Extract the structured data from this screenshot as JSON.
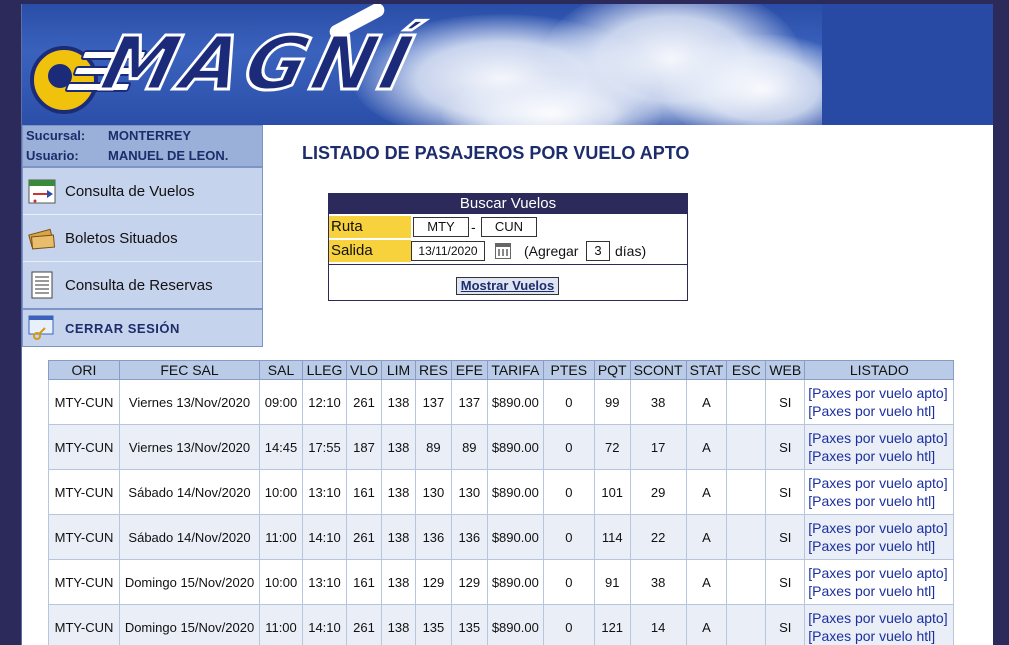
{
  "brand": {
    "logo_text": "MAGNÍ"
  },
  "user_info": {
    "branch_label": "Sucursal:",
    "branch_value": "MONTERREY",
    "user_label": "Usuario:",
    "user_value": "MANUEL DE LEON."
  },
  "menu": {
    "items": [
      {
        "label": "Consulta de Vuelos",
        "icon": "flight-schedule-icon"
      },
      {
        "label": "Boletos Situados",
        "icon": "tickets-icon"
      },
      {
        "label": "Consulta de Reservas",
        "icon": "reservations-list-icon"
      }
    ],
    "logout_label": "CERRAR SESIÓN"
  },
  "page": {
    "title": "LISTADO DE PASAJEROS POR VUELO APTO"
  },
  "search": {
    "header": "Buscar Vuelos",
    "route_label": "Ruta",
    "origin": "MTY",
    "route_separator": "-",
    "destination": "CUN",
    "departure_label": "Salida",
    "departure_date": "13/11/2020",
    "add_prefix": "(Agregar",
    "add_days": "3",
    "add_suffix": "días)",
    "submit_label": "Mostrar Vuelos"
  },
  "table": {
    "headers": [
      "ORI",
      "FEC SAL",
      "SAL",
      "LLEG",
      "VLO",
      "LIM",
      "RES",
      "EFE",
      "TARIFA",
      "PTES",
      "PQT",
      "SCONT",
      "STAT",
      "ESC",
      "WEB",
      "LISTADO"
    ],
    "link_apto": "[Paxes por vuelo apto]",
    "link_htl": "[Paxes por vuelo htl]",
    "rows": [
      [
        "MTY-CUN",
        "Viernes 13/Nov/2020",
        "09:00",
        "12:10",
        "261",
        "138",
        "137",
        "137",
        "$890.00",
        "0",
        "99",
        "38",
        "A",
        "",
        "SI"
      ],
      [
        "MTY-CUN",
        "Viernes 13/Nov/2020",
        "14:45",
        "17:55",
        "187",
        "138",
        "89",
        "89",
        "$890.00",
        "0",
        "72",
        "17",
        "A",
        "",
        "SI"
      ],
      [
        "MTY-CUN",
        "Sábado 14/Nov/2020",
        "10:00",
        "13:10",
        "161",
        "138",
        "130",
        "130",
        "$890.00",
        "0",
        "101",
        "29",
        "A",
        "",
        "SI"
      ],
      [
        "MTY-CUN",
        "Sábado 14/Nov/2020",
        "11:00",
        "14:10",
        "261",
        "138",
        "136",
        "136",
        "$890.00",
        "0",
        "114",
        "22",
        "A",
        "",
        "SI"
      ],
      [
        "MTY-CUN",
        "Domingo 15/Nov/2020",
        "10:00",
        "13:10",
        "161",
        "138",
        "129",
        "129",
        "$890.00",
        "0",
        "91",
        "38",
        "A",
        "",
        "SI"
      ],
      [
        "MTY-CUN",
        "Domingo 15/Nov/2020",
        "11:00",
        "14:10",
        "261",
        "138",
        "135",
        "135",
        "$890.00",
        "0",
        "121",
        "14",
        "A",
        "",
        "SI"
      ]
    ]
  },
  "colors": {
    "page_bg": "#2b2a5a",
    "header_yellow": "#f7d23d",
    "table_header": "#b9cbe6",
    "link": "#1b2fa0",
    "title": "#1d2d6b"
  }
}
